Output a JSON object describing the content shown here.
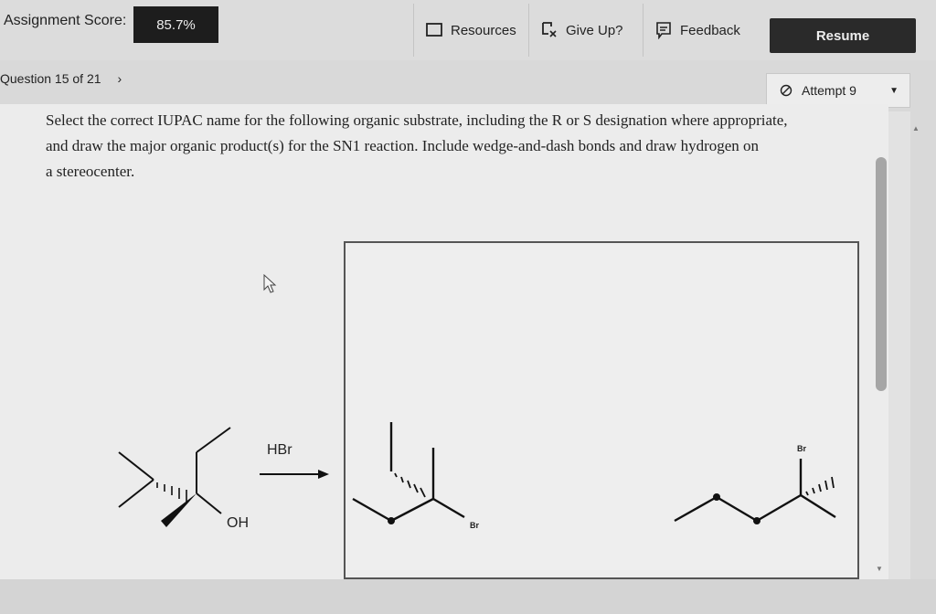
{
  "header": {
    "score_label": "Assignment Score:",
    "score_value": "85.7%",
    "resources_label": "Resources",
    "giveup_label": "Give Up?",
    "feedback_label": "Feedback",
    "resume_label": "Resume"
  },
  "question_nav": {
    "label": "Question 15 of 21",
    "attempt_label": "Attempt 9"
  },
  "question": {
    "line1": "Select the correct IUPAC name for the following organic substrate, including the R or S designation where appropriate,",
    "line2": "and draw the major organic product(s) for the SN1 reaction. Include wedge-and-dash bonds and draw hydrogen on",
    "line3": "a stereocenter."
  },
  "reaction": {
    "reagent": "HBr",
    "substituent_oh": "OH",
    "product_br_1": "Br",
    "product_br_2": "Br"
  },
  "icons": [
    "resources-icon",
    "give-up-icon",
    "feedback-icon",
    "chevron-right-icon",
    "attempt-icon",
    "dropdown-caret-icon",
    "cursor-icon"
  ]
}
